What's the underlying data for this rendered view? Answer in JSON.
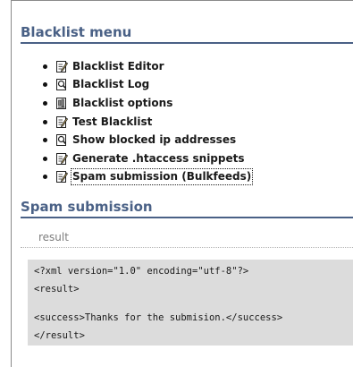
{
  "blacklist_menu": {
    "title": "Blacklist menu",
    "items": [
      {
        "label": "Blacklist Editor",
        "icon": "edit-icon"
      },
      {
        "label": "Blacklist Log",
        "icon": "magnifier-icon"
      },
      {
        "label": "Blacklist options",
        "icon": "options-icon"
      },
      {
        "label": "Test Blacklist",
        "icon": "edit-icon"
      },
      {
        "label": "Show blocked ip addresses",
        "icon": "magnifier-icon"
      },
      {
        "label": "Generate .htaccess snippets",
        "icon": "edit-icon"
      },
      {
        "label": "Spam submission (Bulkfeeds)",
        "icon": "edit-icon"
      }
    ]
  },
  "spam_submission": {
    "title": "Spam submission",
    "tab_label": "result",
    "code_lines": [
      "<?xml version=\"1.0\" encoding=\"utf-8\"?>",
      "<result>",
      "<success>Thanks for the submision.</success>",
      "</result>"
    ]
  }
}
